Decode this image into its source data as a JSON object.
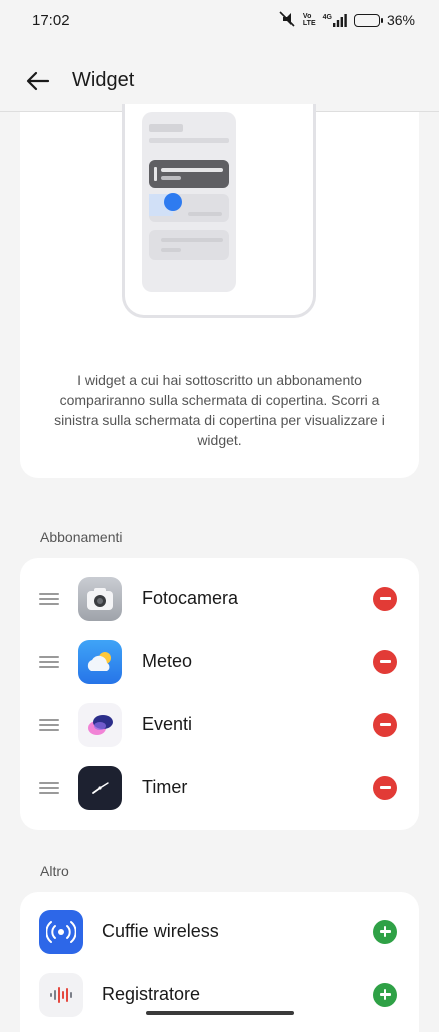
{
  "status_bar": {
    "time": "17:02",
    "net_top": "Vo",
    "net_bottom": "LTE",
    "signal_label": "4G",
    "battery": "36%",
    "battery_level": 0.36,
    "icons": [
      "mute-icon",
      "volte-icon",
      "signal-icon",
      "battery-icon"
    ]
  },
  "header": {
    "title": "Widget",
    "back_icon": "arrow-left-icon"
  },
  "intro": {
    "text": "I widget a cui hai sottoscritto un abbonamento compariranno sulla schermata di copertina. Scorri a sinistra sulla schermata di copertina per visualizzare i widget."
  },
  "subscriptions": {
    "label": "Abbonamenti",
    "items": [
      {
        "name": "Fotocamera",
        "icon": "camera-icon",
        "action": "remove"
      },
      {
        "name": "Meteo",
        "icon": "weather-icon",
        "action": "remove"
      },
      {
        "name": "Eventi",
        "icon": "events-icon",
        "action": "remove"
      },
      {
        "name": "Timer",
        "icon": "clock-icon",
        "action": "remove"
      }
    ]
  },
  "other": {
    "label": "Altro",
    "items": [
      {
        "name": "Cuffie wireless",
        "icon": "wireless-earbuds-icon",
        "action": "add"
      },
      {
        "name": "Registratore",
        "icon": "recorder-icon",
        "action": "add"
      }
    ]
  },
  "colors": {
    "remove": "#e23b36",
    "add": "#2fa146",
    "accent": "#2e7bf0",
    "background": "#f4f4f4"
  }
}
